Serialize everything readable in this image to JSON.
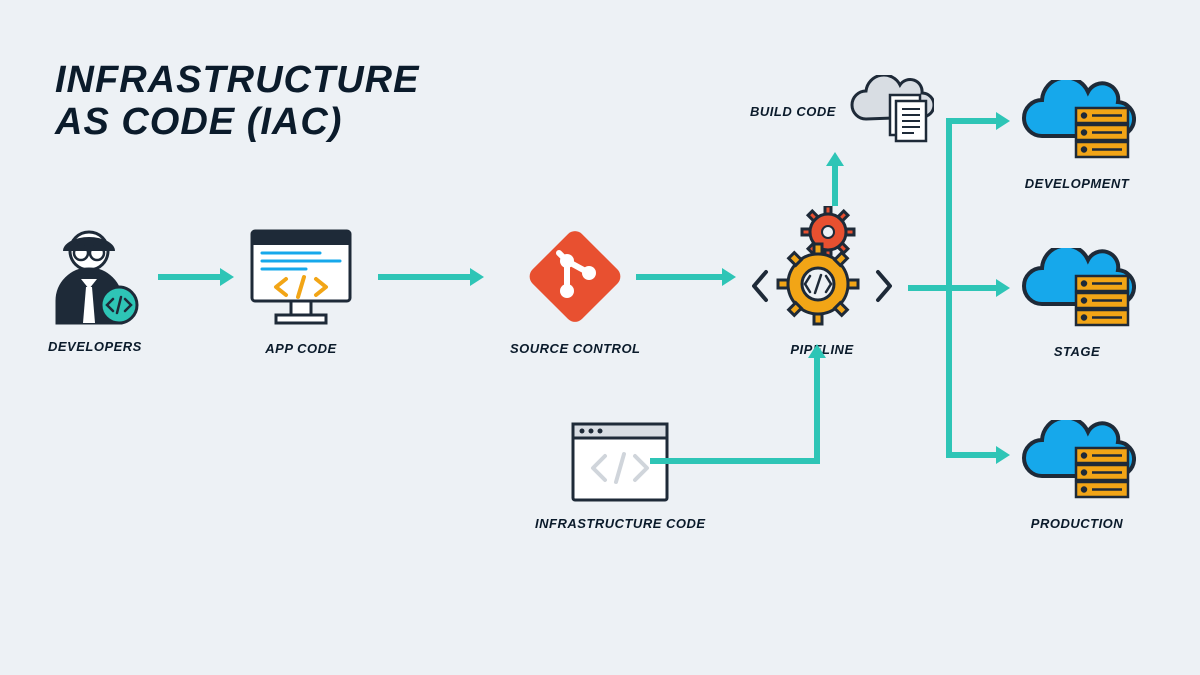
{
  "title_line1": "INFRASTRUCTURE",
  "title_line2": "AS CODE (IAC)",
  "nodes": {
    "developers": "DEVELOPERS",
    "app_code": "APP CODE",
    "source_control": "SOURCE CONTROL",
    "pipeline": "PIPELINE",
    "build_code": "BUILD CODE",
    "infrastructure_code": "INFRASTRUCTURE CODE",
    "development": "DEVELOPMENT",
    "stage": "STAGE",
    "production": "PRODUCTION"
  },
  "colors": {
    "arrow": "#2ec5b6",
    "git": "#e85030",
    "cloud": "#16a8eb",
    "server": "#f2a516",
    "dark": "#0b1b2b",
    "outline": "#1e2a38"
  }
}
